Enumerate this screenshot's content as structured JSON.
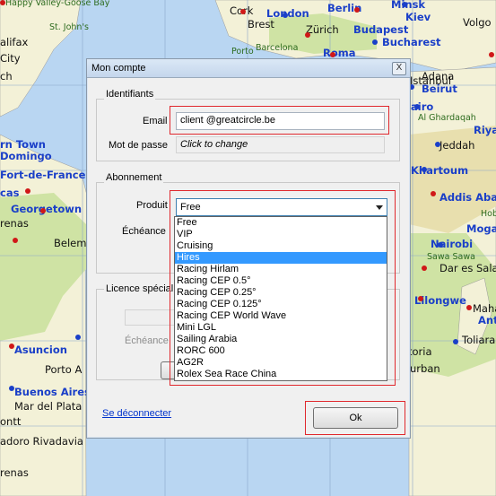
{
  "map": {
    "labels": [
      {
        "t": "Happy Valley-Goose Bay",
        "c": "green"
      },
      {
        "t": "St. John's",
        "c": "green"
      },
      {
        "t": "alifax",
        "c": "black"
      },
      {
        "t": "City",
        "c": "black"
      },
      {
        "t": "ch",
        "c": "black"
      },
      {
        "t": "rn Town",
        "c": "blue"
      },
      {
        "t": "Domingo",
        "c": "blue"
      },
      {
        "t": "Fort-de-France",
        "c": "blue"
      },
      {
        "t": "cas",
        "c": "blue"
      },
      {
        "t": "Georgetown",
        "c": "blue"
      },
      {
        "t": "renas",
        "c": "black"
      },
      {
        "t": "Belem",
        "c": "black"
      },
      {
        "t": "Asuncion",
        "c": "blue"
      },
      {
        "t": "Porto A",
        "c": "black"
      },
      {
        "t": "Buenos Aires",
        "c": "blue"
      },
      {
        "t": "Mar del Plata",
        "c": "black"
      },
      {
        "t": "ontt",
        "c": "black"
      },
      {
        "t": "adoro Rivadavia",
        "c": "black"
      },
      {
        "t": "renas",
        "c": "black"
      },
      {
        "t": "Cork",
        "c": "black"
      },
      {
        "t": "London",
        "c": "blue"
      },
      {
        "t": "Berlin",
        "c": "blue"
      },
      {
        "t": "Minsk",
        "c": "blue"
      },
      {
        "t": "Kiev",
        "c": "blue"
      },
      {
        "t": "Volgo",
        "c": "black"
      },
      {
        "t": "Brest",
        "c": "black"
      },
      {
        "t": "Zürich",
        "c": "black"
      },
      {
        "t": "Budapest",
        "c": "blue"
      },
      {
        "t": "Bucharest",
        "c": "blue"
      },
      {
        "t": "Barcelona",
        "c": "green"
      },
      {
        "t": "Roma",
        "c": "blue"
      },
      {
        "t": "Porto",
        "c": "green"
      },
      {
        "t": "Istanbul",
        "c": "black"
      },
      {
        "t": "Adana",
        "c": "black"
      },
      {
        "t": "Beirut",
        "c": "blue"
      },
      {
        "t": "airo",
        "c": "blue"
      },
      {
        "t": "Al Ghardaqah",
        "c": "green"
      },
      {
        "t": "Riya",
        "c": "blue"
      },
      {
        "t": "Jeddah",
        "c": "black"
      },
      {
        "t": "Khartoum",
        "c": "blue"
      },
      {
        "t": "Addis Aba",
        "c": "blue"
      },
      {
        "t": "Hob",
        "c": "green"
      },
      {
        "t": "Moga",
        "c": "blue"
      },
      {
        "t": "Nairobi",
        "c": "blue"
      },
      {
        "t": "Sawa Sawa",
        "c": "green"
      },
      {
        "t": "Dar es Sala",
        "c": "black"
      },
      {
        "t": "Lilongwe",
        "c": "blue"
      },
      {
        "t": "Mahajan",
        "c": "black"
      },
      {
        "t": "Anta",
        "c": "blue"
      },
      {
        "t": "Toliara",
        "c": "black"
      },
      {
        "t": "toria",
        "c": "black"
      },
      {
        "t": "urban",
        "c": "black"
      }
    ]
  },
  "dialog": {
    "title": "Mon compte",
    "close": "X",
    "identifiants": {
      "title": "Identifiants",
      "email_label": "Email",
      "email_value": "client @greatcircle.be",
      "password_label": "Mot de passe",
      "password_value": "Click to change"
    },
    "abonnement": {
      "title": "Abonnement",
      "produit_label": "Produit",
      "produit_value": "Free",
      "echeance_label": "Échéance",
      "options": [
        "Free",
        "VIP",
        "Cruising",
        "Hires",
        "Racing Hirlam",
        "Racing CEP 0.5°",
        "Racing CEP 0.25°",
        "Racing CEP 0.125°",
        "Racing CEP World Wave",
        "Mini LGL",
        "Sailing Arabia",
        "RORC 600",
        "AG2R",
        "Rolex Sea Race China"
      ],
      "highlighted_option": 3
    },
    "licence": {
      "title": "Licence spécial",
      "echeance_label": "Échéance"
    },
    "disconnect": "Se déconnecter",
    "ok": "Ok"
  }
}
